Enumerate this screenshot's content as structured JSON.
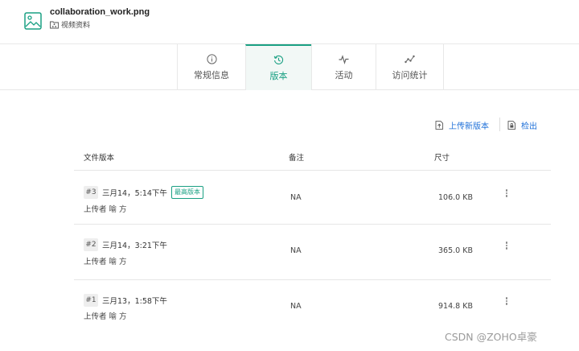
{
  "file": {
    "name": "collaboration_work.png",
    "folder": "视频资料"
  },
  "tabs": [
    {
      "label": "常规信息",
      "icon": "info-circle-icon",
      "active": false
    },
    {
      "label": "版本",
      "icon": "version-history-icon",
      "active": true
    },
    {
      "label": "活动",
      "icon": "activity-pulse-icon",
      "active": false
    },
    {
      "label": "访问统计",
      "icon": "trend-chart-icon",
      "active": false
    }
  ],
  "toolbar": {
    "upload_label": "上传新版本",
    "checkout_label": "检出"
  },
  "table": {
    "columns": {
      "version": "文件版本",
      "note": "备注",
      "size": "尺寸"
    },
    "rows": [
      {
        "badge": "#3",
        "time": "三月14，5:14下午",
        "tag": "最高版本",
        "uploader": "上传者 喻 方",
        "note": "NA",
        "size": "106.0 KB"
      },
      {
        "badge": "#2",
        "time": "三月14，3:21下午",
        "tag": "",
        "uploader": "上传者 喻 方",
        "note": "NA",
        "size": "365.0 KB"
      },
      {
        "badge": "#1",
        "time": "三月13，1:58下午",
        "tag": "",
        "uploader": "上传者 喻 方",
        "note": "NA",
        "size": "914.8 KB"
      }
    ]
  },
  "watermark": "CSDN @ZOHO卓豪",
  "colors": {
    "accent": "#1aa083",
    "link": "#1d6fd8",
    "divider": "#e6e6e6"
  }
}
